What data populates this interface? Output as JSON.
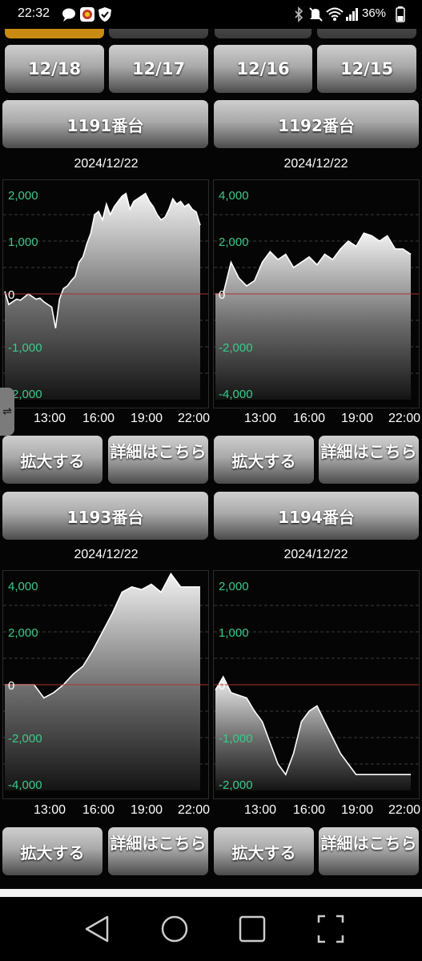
{
  "status_bar": {
    "time": "22:32",
    "battery": "36%",
    "icons": [
      "chat-bubble-icon",
      "app-icon",
      "shield-check-icon",
      "bluetooth-icon",
      "mute-icon",
      "wifi-icon",
      "signal-icon",
      "battery-icon"
    ]
  },
  "date_buttons": [
    "12/18",
    "12/17",
    "12/16",
    "12/15"
  ],
  "machines": [
    {
      "title": "1191番台",
      "date": "2024/12/22",
      "zoom": "拡大する",
      "detail": "詳細はこちら",
      "y_ticks": [
        "2,000",
        "1,000",
        "0",
        "-1,000",
        "-2,000"
      ],
      "x_ticks": [
        "13:00",
        "16:00",
        "19:00",
        "22:00"
      ]
    },
    {
      "title": "1192番台",
      "date": "2024/12/22",
      "zoom": "拡大する",
      "detail": "詳細はこちら",
      "y_ticks": [
        "4,000",
        "2,000",
        "0",
        "-2,000",
        "-4,000"
      ],
      "x_ticks": [
        "13:00",
        "16:00",
        "19:00",
        "22:00"
      ]
    },
    {
      "title": "1193番台",
      "date": "2024/12/22",
      "zoom": "拡大する",
      "detail": "詳細はこちら",
      "y_ticks": [
        "4,000",
        "2,000",
        "0",
        "-2,000",
        "-4,000"
      ],
      "x_ticks": [
        "13:00",
        "16:00",
        "19:00",
        "22:00"
      ]
    },
    {
      "title": "1194番台",
      "date": "2024/12/22",
      "zoom": "拡大する",
      "detail": "詳細はこちら",
      "y_ticks": [
        "2,000",
        "1,000",
        "0",
        "-1,000",
        "-2,000"
      ],
      "x_ticks": [
        "13:00",
        "16:00",
        "19:00",
        "22:00"
      ]
    }
  ],
  "chart_data": [
    {
      "type": "area",
      "ylim": [
        -2000,
        2000
      ],
      "x": [
        0,
        2,
        4,
        6,
        8,
        10,
        12,
        14,
        16,
        18,
        20,
        22,
        24,
        26,
        28,
        30,
        32,
        34,
        36,
        38,
        40,
        42,
        44,
        46,
        48,
        50,
        52,
        54,
        56,
        58,
        60,
        62,
        64,
        66,
        68,
        70,
        72,
        74,
        76,
        78,
        80,
        82,
        84,
        86,
        88,
        90,
        92,
        94,
        96,
        98,
        100
      ],
      "y": [
        50,
        -200,
        -150,
        -100,
        -120,
        -60,
        0,
        -50,
        -100,
        -80,
        -150,
        -200,
        -250,
        -650,
        -100,
        100,
        150,
        250,
        330,
        600,
        700,
        950,
        1150,
        1500,
        1560,
        1400,
        1700,
        1500,
        1650,
        1750,
        1850,
        1900,
        1600,
        1750,
        1800,
        1850,
        1900,
        1750,
        1650,
        1500,
        1400,
        1450,
        1600,
        1800,
        1700,
        1750,
        1650,
        1700,
        1600,
        1550,
        1300
      ]
    },
    {
      "type": "area",
      "ylim": [
        -4000,
        4000
      ],
      "x": [
        0,
        4,
        8,
        12,
        16,
        20,
        24,
        28,
        32,
        36,
        40,
        44,
        48,
        52,
        56,
        60,
        64,
        68,
        72,
        76,
        80,
        84,
        88,
        92,
        96,
        100
      ],
      "y": [
        0,
        0,
        1200,
        600,
        300,
        500,
        1200,
        1600,
        1300,
        1500,
        1000,
        1200,
        1400,
        1100,
        1500,
        1300,
        1700,
        2000,
        1800,
        2300,
        2200,
        2000,
        2200,
        1700,
        1700,
        1500
      ]
    },
    {
      "type": "area",
      "ylim": [
        -4000,
        4000
      ],
      "x": [
        0,
        5,
        10,
        15,
        20,
        25,
        30,
        35,
        40,
        45,
        50,
        55,
        60,
        65,
        70,
        75,
        80,
        85,
        90,
        95,
        100
      ],
      "y": [
        0,
        0,
        0,
        0,
        -500,
        -300,
        0,
        400,
        700,
        1300,
        2000,
        2700,
        3500,
        3700,
        3600,
        3800,
        3500,
        4200,
        3700,
        3700,
        3700
      ]
    },
    {
      "type": "area",
      "ylim": [
        -2000,
        2000
      ],
      "x": [
        0,
        4,
        8,
        12,
        16,
        20,
        24,
        28,
        32,
        36,
        40,
        44,
        48,
        52,
        56,
        60,
        64,
        68,
        72,
        76,
        80,
        84,
        88,
        92,
        96,
        100
      ],
      "y": [
        -100,
        150,
        -150,
        -200,
        -250,
        -500,
        -700,
        -1100,
        -1500,
        -1700,
        -1300,
        -700,
        -500,
        -400,
        -700,
        -1000,
        -1300,
        -1500,
        -1700,
        -1700,
        -1700,
        -1700,
        -1700,
        -1700,
        -1700,
        -1700
      ]
    }
  ]
}
